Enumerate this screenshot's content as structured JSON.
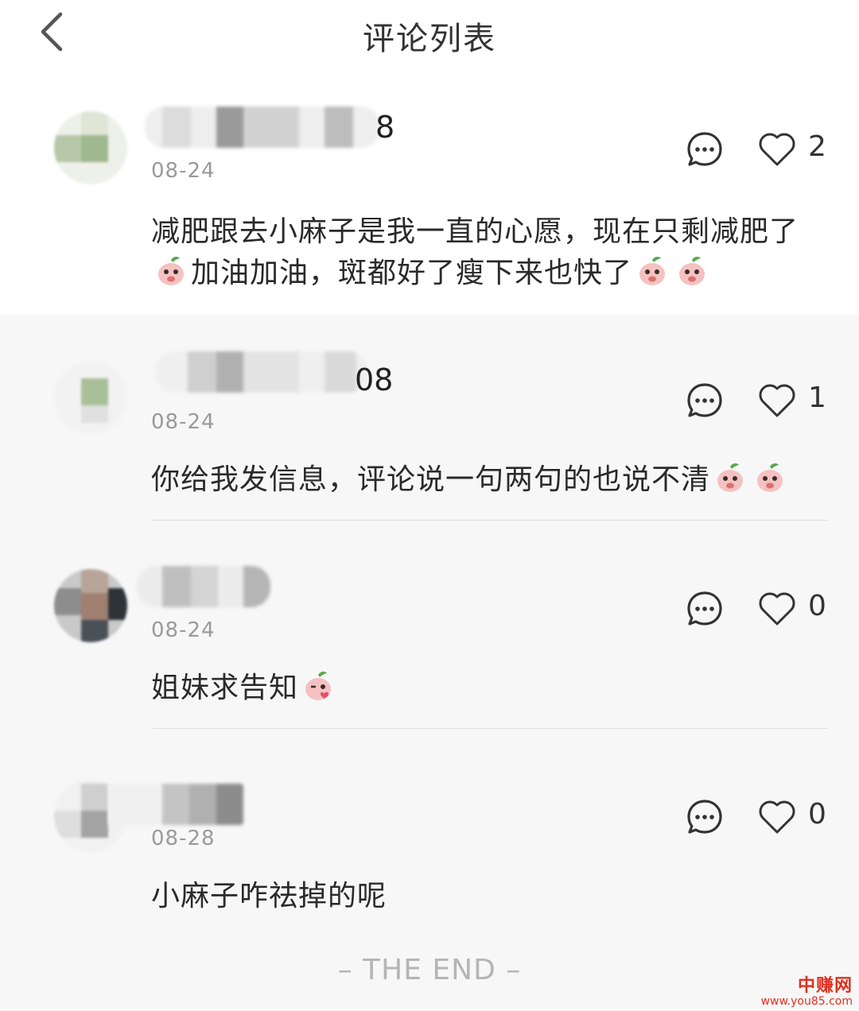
{
  "header": {
    "title": "评论列表",
    "back_icon": "chevron-left-icon"
  },
  "comments": [
    {
      "name_tail": "8",
      "date": "08-24",
      "likes": "2",
      "text_parts": [
        "减肥跟去小麻子是我一直的心愿，现在只剩减肥了",
        "加油加油，斑都好了瘦下来也快了"
      ]
    },
    {
      "name_tail": "08",
      "date": "08-24",
      "likes": "1",
      "text_parts": [
        "你给我发信息，评论说一句两句的也说不清"
      ]
    },
    {
      "name_tail": "",
      "date": "08-24",
      "likes": "0",
      "text_parts": [
        "姐妹求告知"
      ]
    },
    {
      "name_tail": "",
      "date": "08-28",
      "likes": "0",
      "text_parts": [
        "小麻子咋祛掉的呢"
      ]
    }
  ],
  "footer": {
    "end_text": "– THE END –"
  },
  "watermark": {
    "top": "中赚网",
    "bottom": "www.you85.com"
  },
  "colors": {
    "background": "#f7f7f8",
    "first_card": "#ffffff",
    "date": "#9a9a9a",
    "icon": "#333333",
    "watermark": "#e0301e"
  }
}
